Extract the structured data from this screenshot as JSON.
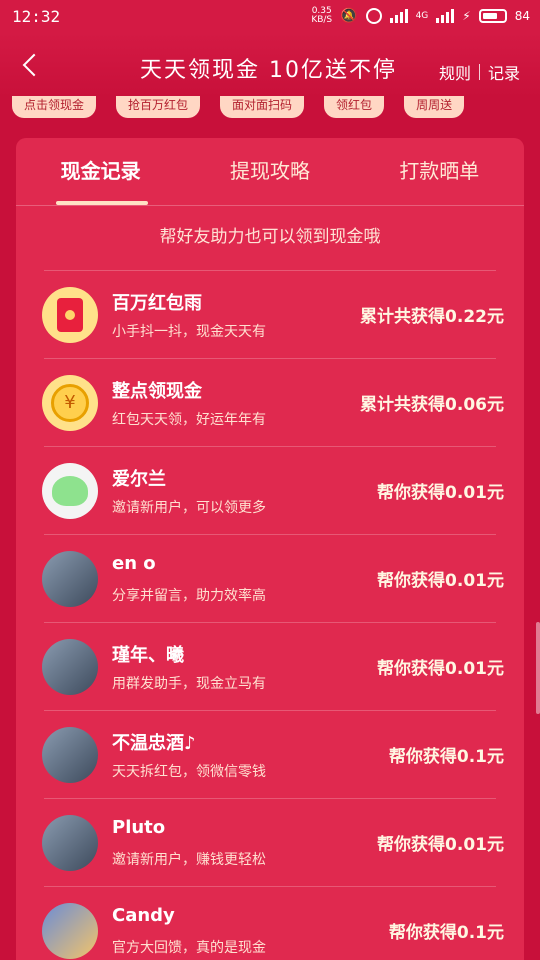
{
  "status": {
    "time": "12:32",
    "net_speed": "0.35\nKB/S",
    "net_type": "4G",
    "battery": "84"
  },
  "header": {
    "title": "天天领现金 10亿送不停",
    "rules_label": "规则",
    "record_label": "记录"
  },
  "chips": [
    "点击领现金",
    "抢百万红包",
    "面对面扫码",
    "领红包",
    "周周送"
  ],
  "tabs": [
    "现金记录",
    "提现攻略",
    "打款晒单"
  ],
  "hint": "帮好友助力也可以领到现金哦",
  "items": [
    {
      "name": "百万红包雨",
      "desc": "小手抖一抖，现金天天有",
      "amount": "累计共获得0.22元",
      "icon": "red-envelope-icon"
    },
    {
      "name": "整点领现金",
      "desc": "红包天天领，好运年年有",
      "amount": "累计共获得0.06元",
      "icon": "alarm-clock-icon"
    },
    {
      "name": "爱尔兰",
      "desc": "邀请新用户，可以领更多",
      "amount": "帮你获得0.01元",
      "icon": "avatar"
    },
    {
      "name": "en o",
      "desc": "分享并留言，助力效率高",
      "amount": "帮你获得0.01元",
      "icon": "avatar"
    },
    {
      "name": "瑾年、曦",
      "desc": "用群发助手，现金立马有",
      "amount": "帮你获得0.01元",
      "icon": "avatar"
    },
    {
      "name": "不温忠酒♪",
      "desc": "天天拆红包，领微信零钱",
      "amount": "帮你获得0.1元",
      "icon": "avatar"
    },
    {
      "name": "Pluto",
      "desc": "邀请新用户，赚钱更轻松",
      "amount": "帮你获得0.01元",
      "icon": "avatar"
    },
    {
      "name": "Candy",
      "desc": "官方大回馈，真的是现金",
      "amount": "帮你获得0.1元",
      "icon": "avatar"
    }
  ]
}
